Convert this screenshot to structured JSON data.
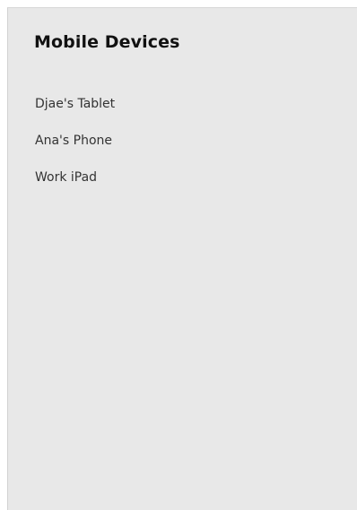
{
  "panel": {
    "title": "Mobile Devices"
  },
  "devices": [
    {
      "label": "Djae's Tablet"
    },
    {
      "label": "Ana's Phone"
    },
    {
      "label": "Work iPad"
    }
  ]
}
